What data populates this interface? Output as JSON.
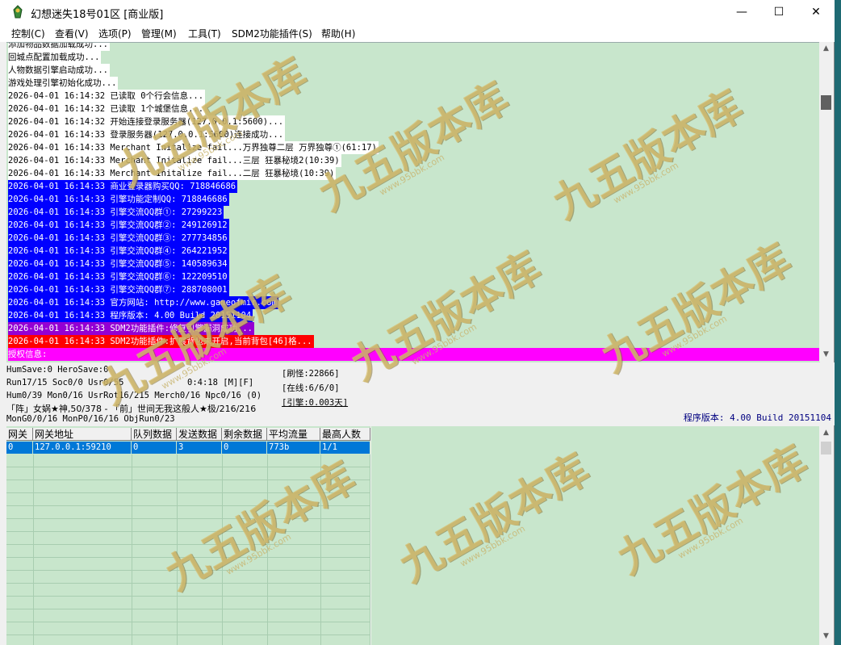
{
  "window": {
    "title": "幻想迷失18号01区 [商业版]",
    "minimize": "—",
    "maximize": "☐",
    "close": "✕"
  },
  "menu": [
    {
      "label": "控制(C)"
    },
    {
      "label": "查看(V)"
    },
    {
      "label": "选项(P)"
    },
    {
      "label": "管理(M)"
    },
    {
      "label": "工具(T)"
    },
    {
      "label": "SDM2功能插件(S)"
    },
    {
      "label": "帮助(H)"
    }
  ],
  "log": [
    {
      "text": "添加物品数据加载成功...",
      "bg": "#ffffff",
      "fg": "#000000"
    },
    {
      "text": "回城点配置加载成功...",
      "bg": "#ffffff",
      "fg": "#000000"
    },
    {
      "text": "人物数据引擎启动成功...",
      "bg": "#ffffff",
      "fg": "#000000"
    },
    {
      "text": "游戏处理引擎初始化成功...",
      "bg": "#ffffff",
      "fg": "#000000"
    },
    {
      "text": "2026-04-01 16:14:32 已读取 0个行会信息...",
      "bg": "#ffffff",
      "fg": "#000000"
    },
    {
      "text": "2026-04-01 16:14:32 已读取 1个城堡信息...",
      "bg": "#ffffff",
      "fg": "#000000"
    },
    {
      "text": "2026-04-01 16:14:32 开始连接登录服务器(127.0.0.1:5600)...",
      "bg": "#ffffff",
      "fg": "#000000"
    },
    {
      "text": "2026-04-01 16:14:33 登录服务器(127.0.0.1:5600)连接成功...",
      "bg": "#ffffff",
      "fg": "#000000"
    },
    {
      "text": "2026-04-01 16:14:33 Merchant Initalize fail...万界独尊二层 万界独尊①(61:17)",
      "bg": "#ffffff",
      "fg": "#000000"
    },
    {
      "text": "2026-04-01 16:14:33 Merchant Initalize fail...三层 狂暴秘境2(10:39)",
      "bg": "#ffffff",
      "fg": "#000000"
    },
    {
      "text": "2026-04-01 16:14:33 Merchant Initalize fail...二层 狂暴秘境(10:39)",
      "bg": "#ffffff",
      "fg": "#000000"
    },
    {
      "text": "2026-04-01 16:14:33 商业登录器购买QQ: 718846686",
      "bg": "#0000ff",
      "fg": "#ffffff"
    },
    {
      "text": "2026-04-01 16:14:33 引擎功能定制QQ: 718846686",
      "bg": "#0000ff",
      "fg": "#ffffff"
    },
    {
      "text": "2026-04-01 16:14:33 引擎交流QQ群①: 27299223",
      "bg": "#0000ff",
      "fg": "#ffffff"
    },
    {
      "text": "2026-04-01 16:14:33 引擎交流QQ群②: 249126912",
      "bg": "#0000ff",
      "fg": "#ffffff"
    },
    {
      "text": "2026-04-01 16:14:33 引擎交流QQ群③: 277734856",
      "bg": "#0000ff",
      "fg": "#ffffff"
    },
    {
      "text": "2026-04-01 16:14:33 引擎交流QQ群④: 264221952",
      "bg": "#0000ff",
      "fg": "#ffffff"
    },
    {
      "text": "2026-04-01 16:14:33 引擎交流QQ群⑤: 140589634",
      "bg": "#0000ff",
      "fg": "#ffffff"
    },
    {
      "text": "2026-04-01 16:14:33 引擎交流QQ群⑥: 122209510",
      "bg": "#0000ff",
      "fg": "#ffffff"
    },
    {
      "text": "2026-04-01 16:14:33 引擎交流QQ群⑦: 288708001",
      "bg": "#0000ff",
      "fg": "#ffffff"
    },
    {
      "text": "2026-04-01 16:14:33 官方网站: http://www.gameofmir.com",
      "bg": "#0000ff",
      "fg": "#ffffff"
    },
    {
      "text": "2026-04-01 16:14:33 程序版本: 4.00 Build 20151104",
      "bg": "#0000ff",
      "fg": "#ffffff"
    },
    {
      "text": "2026-04-01 16:14:33 SDM2功能插件:修复引擎漏洞成功...",
      "bg": "#9400d3",
      "fg": "#ffffff"
    },
    {
      "text": "2026-04-01 16:14:33 SDM2功能插件:扩展背包未开启,当前背包[46]格...",
      "bg": "#ff0000",
      "fg": "#ffffff"
    },
    {
      "text": "授权信息:",
      "bg": "#ff00ff",
      "fg": "#ffffff"
    }
  ],
  "status": {
    "line1": "HumSave:0 HeroSave:0",
    "line2a": "Run17/15 Soc0/0 Usr0/55",
    "line2b": "0:4:18 [M][F]",
    "line3": "Hum0/39 Mon0/16 UsrRot16/215 Merch0/16 Npc0/16 (0)",
    "line4": "「阵」女娲★神,50/378 - 「前」世间无我这般人★极/216/216",
    "line5": "MonG0/0/16 MonP0/16/16 ObjRun0/23",
    "refresh": "[刷怪:22866]",
    "online": "[在线:6/6/0]",
    "engine": "[引擎:0.003天]",
    "version": "程序版本: 4.00 Build 20151104"
  },
  "grid": {
    "headers": [
      "网关",
      "网关地址",
      "队列数据",
      "发送数据",
      "剩余数据",
      "平均流量",
      "最高人数"
    ],
    "rows": [
      [
        "0",
        "127.0.0.1:59210",
        "0",
        "3",
        "0",
        "773b",
        "1/1"
      ]
    ]
  },
  "watermark": {
    "text": "九五版本库",
    "url": "www.95bbk.com"
  }
}
